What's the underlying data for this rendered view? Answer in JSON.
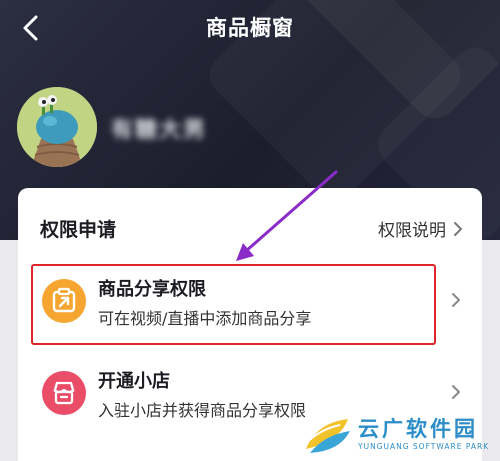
{
  "header": {
    "title": "商品橱窗",
    "back_icon": "chevron-left-icon",
    "username": "有糖大男"
  },
  "card": {
    "title": "权限申请",
    "permission_link": "权限说明"
  },
  "rows": [
    {
      "icon": "share-box-icon",
      "icon_color": "#f7a531",
      "title": "商品分享权限",
      "subtitle": "可在视频/直播中添加商品分享"
    },
    {
      "icon": "shop-icon",
      "icon_color": "#e94d67",
      "title": "开通小店",
      "subtitle": "入驻小店并获得商品分享权限"
    }
  ],
  "annotation": {
    "highlight_color": "#e0242b",
    "arrow_color": "#8b2cc9"
  },
  "watermark": {
    "main": "云广软件园",
    "sub": "YUNGUANG SOFTWARE PARK"
  }
}
